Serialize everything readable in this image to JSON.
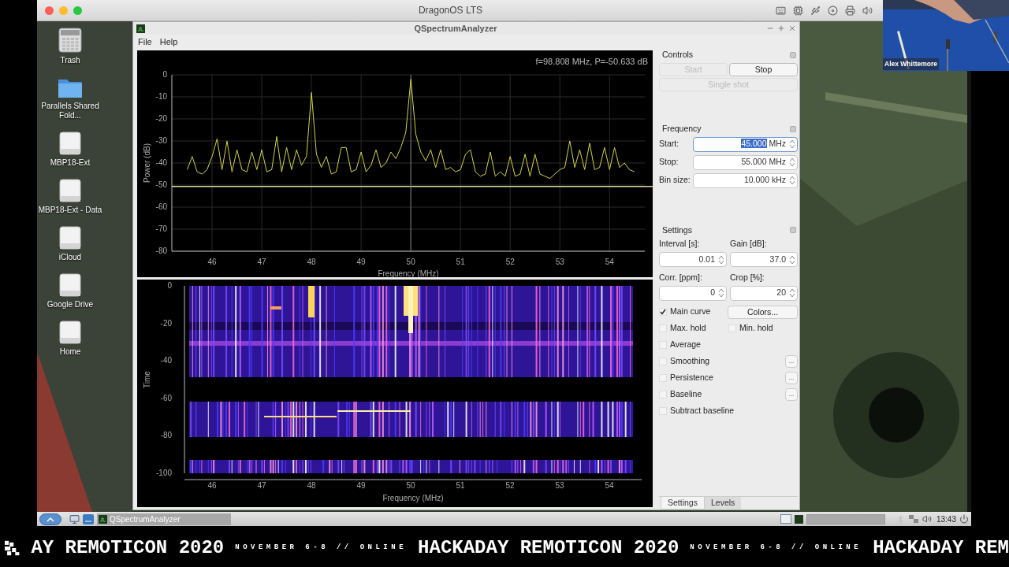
{
  "host_window": {
    "title": "DragonOS LTS"
  },
  "desktop_icons": [
    {
      "label": "Trash",
      "kind": "trash"
    },
    {
      "label": "Parallels Shared Fold...",
      "kind": "folder"
    },
    {
      "label": "MBP18-Ext",
      "kind": "drive"
    },
    {
      "label": "MBP18-Ext - Data",
      "kind": "drive"
    },
    {
      "label": "iCloud",
      "kind": "drive"
    },
    {
      "label": "Google Drive",
      "kind": "drive"
    },
    {
      "label": "Home",
      "kind": "drive"
    }
  ],
  "app": {
    "title": "QSpectrumAnalyzer",
    "menu": [
      "File",
      "Help"
    ],
    "spectrum": {
      "readout": "f=98.808 MHz, P=-50.633 dB",
      "chart_data": {
        "type": "line",
        "xlabel": "Frequency (MHz)",
        "ylabel": "Power (dB)",
        "xlim": [
          45.19,
          54.71
        ],
        "ylim": [
          -80,
          0
        ],
        "xticks": [
          46,
          47,
          48,
          49,
          50,
          51,
          52,
          53,
          54
        ],
        "yticks": [
          0,
          -10,
          -20,
          -30,
          -40,
          -50,
          -60,
          -70,
          -80
        ],
        "x": [
          45.5,
          45.6,
          45.7,
          45.8,
          45.9,
          46.0,
          46.1,
          46.2,
          46.3,
          46.4,
          46.5,
          46.6,
          46.7,
          46.8,
          46.9,
          47.0,
          47.1,
          47.2,
          47.3,
          47.4,
          47.5,
          47.6,
          47.7,
          47.8,
          47.9,
          48.0,
          48.1,
          48.2,
          48.3,
          48.4,
          48.5,
          48.6,
          48.7,
          48.8,
          48.9,
          49.0,
          49.1,
          49.2,
          49.3,
          49.4,
          49.5,
          49.6,
          49.7,
          49.8,
          49.9,
          50.0,
          50.1,
          50.2,
          50.3,
          50.4,
          50.5,
          50.6,
          50.7,
          50.8,
          50.9,
          51.0,
          51.1,
          51.2,
          51.3,
          51.4,
          51.5,
          51.6,
          51.7,
          51.8,
          51.9,
          52.0,
          52.1,
          52.2,
          52.3,
          52.4,
          52.5,
          52.6,
          52.7,
          52.8,
          52.9,
          53.0,
          53.1,
          53.2,
          53.3,
          53.4,
          53.5,
          53.6,
          53.7,
          53.8,
          53.9,
          54.0,
          54.1,
          54.2,
          54.3,
          54.4,
          54.5
        ],
        "series": [
          {
            "color": "#d6d63a",
            "values": [
              -43,
              -37,
              -44,
              -45,
              -43,
              -37,
              -29,
              -43,
              -30,
              -44,
              -34,
              -43,
              -44,
              -35,
              -43,
              -34,
              -44,
              -43,
              -28,
              -44,
              -33,
              -43,
              -34,
              -41,
              -37,
              -8,
              -36,
              -42,
              -37,
              -45,
              -44,
              -33,
              -33,
              -44,
              -43,
              -35,
              -44,
              -41,
              -34,
              -42,
              -40,
              -35,
              -38,
              -33,
              -26,
              -2,
              -27,
              -35,
              -39,
              -34,
              -42,
              -34,
              -43,
              -42,
              -44,
              -43,
              -36,
              -34,
              -44,
              -46,
              -45,
              -35,
              -46,
              -44,
              -46,
              -37,
              -46,
              -45,
              -36,
              -46,
              -36,
              -45,
              -46,
              -47,
              -45,
              -43,
              -42,
              -30,
              -42,
              -34,
              -43,
              -31,
              -43,
              -42,
              -33,
              -43,
              -33,
              -42,
              -40,
              -43,
              -44
            ]
          }
        ],
        "grid": true,
        "ref_lines": [
          {
            "axis": "y",
            "value": -50.633
          },
          {
            "axis": "x",
            "value": 50
          }
        ]
      }
    },
    "waterfall": {
      "ylabel": "Time",
      "xlabel": "Frequency (MHz)",
      "yticks": [
        "0",
        "-20",
        "-40",
        "-60",
        "-80",
        "-100"
      ],
      "xticks": [
        "46",
        "47",
        "48",
        "49",
        "50",
        "51",
        "52",
        "53",
        "54"
      ]
    },
    "controls": {
      "title": "Controls",
      "buttons": [
        {
          "label": "Start",
          "disabled": true
        },
        {
          "label": "Stop",
          "disabled": false
        },
        {
          "label": "Single shot",
          "disabled": true
        }
      ]
    },
    "frequency": {
      "title": "Frequency",
      "fields": [
        {
          "label": "Start:",
          "value": "45.000",
          "unit": "MHz",
          "selected": true
        },
        {
          "label": "Stop:",
          "value": "55.000",
          "unit": "MHz",
          "selected": false
        },
        {
          "label": "Bin size:",
          "value": "10.000",
          "unit": "kHz",
          "selected": false
        }
      ]
    },
    "settings": {
      "title": "Settings",
      "spinboxes": [
        {
          "label": "Interval [s]:",
          "value": "0.01"
        },
        {
          "label": "Gain [dB]:",
          "value": "37.0"
        },
        {
          "label": "Corr. [ppm]:",
          "value": "0"
        },
        {
          "label": "Crop [%]:",
          "value": "20"
        }
      ],
      "rows": [
        {
          "items": [
            {
              "kind": "checkbox",
              "label": "Main curve",
              "checked": true
            },
            {
              "kind": "button",
              "label": "Colors..."
            }
          ]
        },
        {
          "items": [
            {
              "kind": "checkbox",
              "label": "Max. hold",
              "checked": false
            },
            {
              "kind": "checkbox",
              "label": "Min. hold",
              "checked": false
            }
          ]
        },
        {
          "items": [
            {
              "kind": "checkbox",
              "label": "Average",
              "checked": false
            }
          ]
        },
        {
          "items": [
            {
              "kind": "checkbox",
              "label": "Smoothing",
              "checked": false
            },
            {
              "kind": "more",
              "label": "..."
            }
          ]
        },
        {
          "items": [
            {
              "kind": "checkbox",
              "label": "Persistence",
              "checked": false
            },
            {
              "kind": "more",
              "label": "..."
            }
          ]
        },
        {
          "items": [
            {
              "kind": "checkbox",
              "label": "Baseline",
              "checked": false
            },
            {
              "kind": "more",
              "label": "..."
            }
          ]
        },
        {
          "items": [
            {
              "kind": "checkbox",
              "label": "Subtract baseline",
              "checked": false
            }
          ]
        }
      ]
    },
    "tabs": [
      {
        "label": "Settings",
        "selected": true
      },
      {
        "label": "Levels",
        "selected": false
      }
    ]
  },
  "taskbar": {
    "tasks": [
      {
        "label": "QSpectrumAnalyzer",
        "selected": true
      }
    ],
    "clock": "13:43"
  },
  "webcam": {
    "name": "Alex Whittemore"
  },
  "banner": {
    "segments": [
      {
        "kind": "title",
        "text": "AY REMOTICON 2020"
      },
      {
        "kind": "subtitle",
        "text": "NOVEMBER 6-8 // ONLINE"
      },
      {
        "kind": "title",
        "text": "HACKADAY REMOTICON 2020"
      },
      {
        "kind": "subtitle",
        "text": "NOVEMBER 6-8 // ONLINE"
      },
      {
        "kind": "title",
        "text": "HACKADAY REM"
      }
    ]
  }
}
